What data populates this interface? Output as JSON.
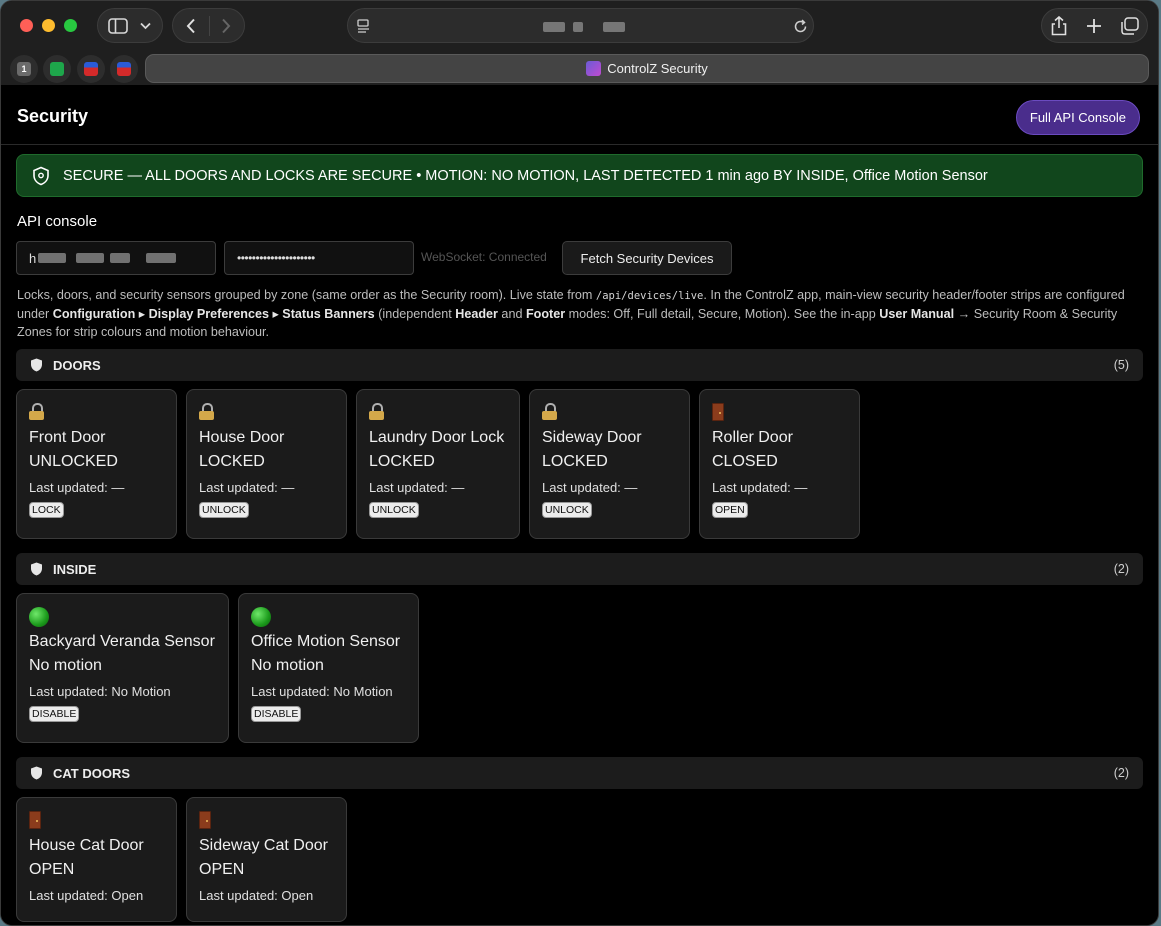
{
  "browser": {
    "tab_title": "ControlZ Security",
    "pinned_tabs": [
      {
        "icon": "1",
        "color": "#6b6b6b"
      },
      {
        "icon": "",
        "color": "#1ea64b"
      },
      {
        "icon": "",
        "color": "#d42a2a"
      },
      {
        "icon": "",
        "color": "#d42a2a"
      }
    ]
  },
  "header": {
    "title": "Security",
    "console_button": "Full API Console"
  },
  "banner": {
    "text": "SECURE — ALL DOORS AND LOCKS ARE SECURE • MOTION: NO MOTION, LAST DETECTED 1 min ago BY INSIDE, Office Motion Sensor",
    "color": "#11461c"
  },
  "api_console": {
    "label": "API console",
    "url_prefix": "h",
    "token_value": "•••••••••••••••••••••",
    "ws_status": "WebSocket: Connected",
    "fetch_button": "Fetch Security Devices"
  },
  "description": {
    "p1": "Locks, doors, and security sensors grouped by zone (same order as the Security room). Live state from ",
    "code": "/api/devices/live",
    "p2": ". In the ControlZ app, main-view security header/footer strips are configured under ",
    "b1": "Configuration ▸ Display Preferences ▸ Status Banners",
    "p3": " (independent ",
    "b2": "Header",
    "p4": " and ",
    "b3": "Footer",
    "p5": " modes: Off, Full detail, Secure, Motion). See the in-app ",
    "b4": "User Manual",
    "p6": " → Security Room & Security Zones for strip colours and motion behaviour."
  },
  "zones": [
    {
      "name": "DOORS",
      "count": "(5)",
      "devices": [
        {
          "icon": "lock-icon",
          "name": "Front Door",
          "state": "UNLOCKED",
          "updated": "Last updated: —",
          "action": "LOCK"
        },
        {
          "icon": "lock-icon",
          "name": "House Door",
          "state": "LOCKED",
          "updated": "Last updated: —",
          "action": "UNLOCK"
        },
        {
          "icon": "lock-icon",
          "name": "Laundry Door Lock",
          "state": "LOCKED",
          "updated": "Last updated: —",
          "action": "UNLOCK"
        },
        {
          "icon": "lock-icon",
          "name": "Sideway Door",
          "state": "LOCKED",
          "updated": "Last updated: —",
          "action": "UNLOCK"
        },
        {
          "icon": "door-icon",
          "name": "Roller Door",
          "state": "CLOSED",
          "updated": "Last updated: —",
          "action": "OPEN"
        }
      ]
    },
    {
      "name": "INSIDE",
      "count": "(2)",
      "devices": [
        {
          "icon": "green-circle-icon",
          "name": "Backyard Veranda Sensor",
          "state": "No motion",
          "updated": "Last updated: No Motion",
          "action": "DISABLE"
        },
        {
          "icon": "green-circle-icon",
          "name": "Office Motion Sensor",
          "state": "No motion",
          "updated": "Last updated: No Motion",
          "action": "DISABLE"
        }
      ]
    },
    {
      "name": "CAT DOORS",
      "count": "(2)",
      "devices": [
        {
          "icon": "door-icon",
          "name": "House Cat Door",
          "state": "OPEN",
          "updated": "Last updated: Open",
          "action": ""
        },
        {
          "icon": "door-icon",
          "name": "Sideway Cat Door",
          "state": "OPEN",
          "updated": "Last updated: Open",
          "action": ""
        }
      ]
    }
  ]
}
